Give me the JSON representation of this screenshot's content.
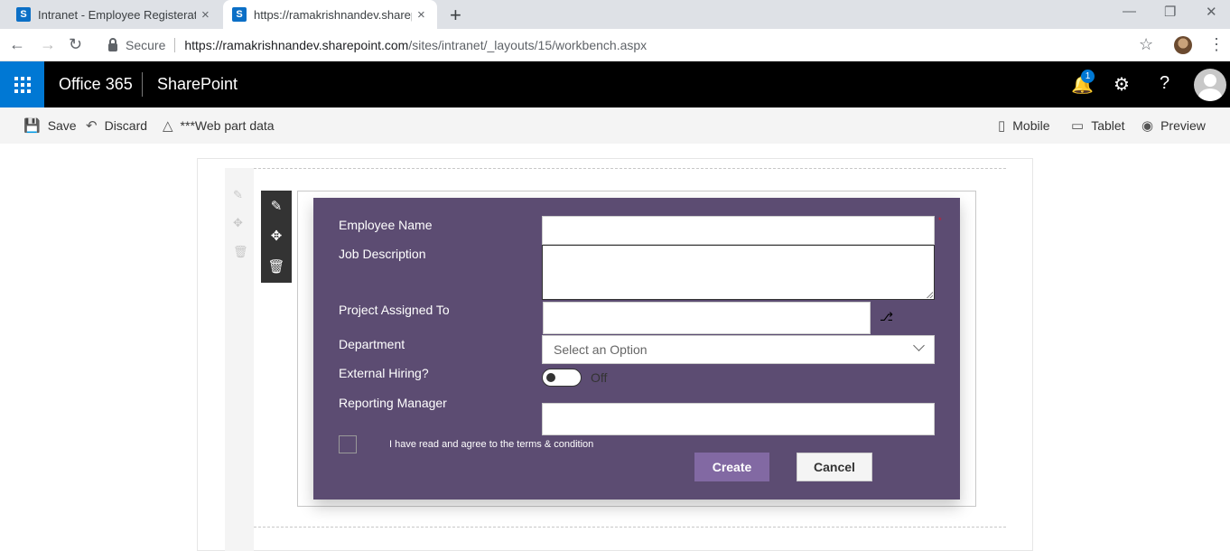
{
  "browser": {
    "tabs": [
      {
        "icon": "S",
        "title": "Intranet - Employee Registeration",
        "close": "×"
      },
      {
        "icon": "S",
        "title": "https://ramakrishnandev.sharepoint.com",
        "close": "×"
      }
    ],
    "new_tab": "+",
    "secure_label": "Secure",
    "url_host": "https://ramakrishnandev.sharepoint.com",
    "url_path": "/sites/intranet/_layouts/15/workbench.aspx"
  },
  "officebar": {
    "brand": "Office 365",
    "app": "SharePoint",
    "notification_count": "1",
    "help": "?"
  },
  "commandbar": {
    "save": "Save",
    "discard": "Discard",
    "webpart_data": "***Web part data",
    "mobile": "Mobile",
    "tablet": "Tablet",
    "preview": "Preview"
  },
  "form": {
    "employee_name_label": "Employee Name",
    "employee_name_value": "",
    "job_description_label": "Job Description",
    "job_description_value": "",
    "project_label": "Project Assigned To",
    "project_value": "",
    "department_label": "Department",
    "department_placeholder": "Select an Option",
    "external_hiring_label": "External Hiring?",
    "external_hiring_state": "Off",
    "reporting_manager_label": "Reporting Manager",
    "reporting_manager_value": "",
    "terms_text": "I have read and agree to the terms & condition",
    "create_label": "Create",
    "cancel_label": "Cancel",
    "required_marker": "*"
  },
  "colors": {
    "form_bg": "#5c4c72",
    "primary_button": "#8269a3",
    "suite_bar": "#000000",
    "waffle": "#0078d4"
  }
}
